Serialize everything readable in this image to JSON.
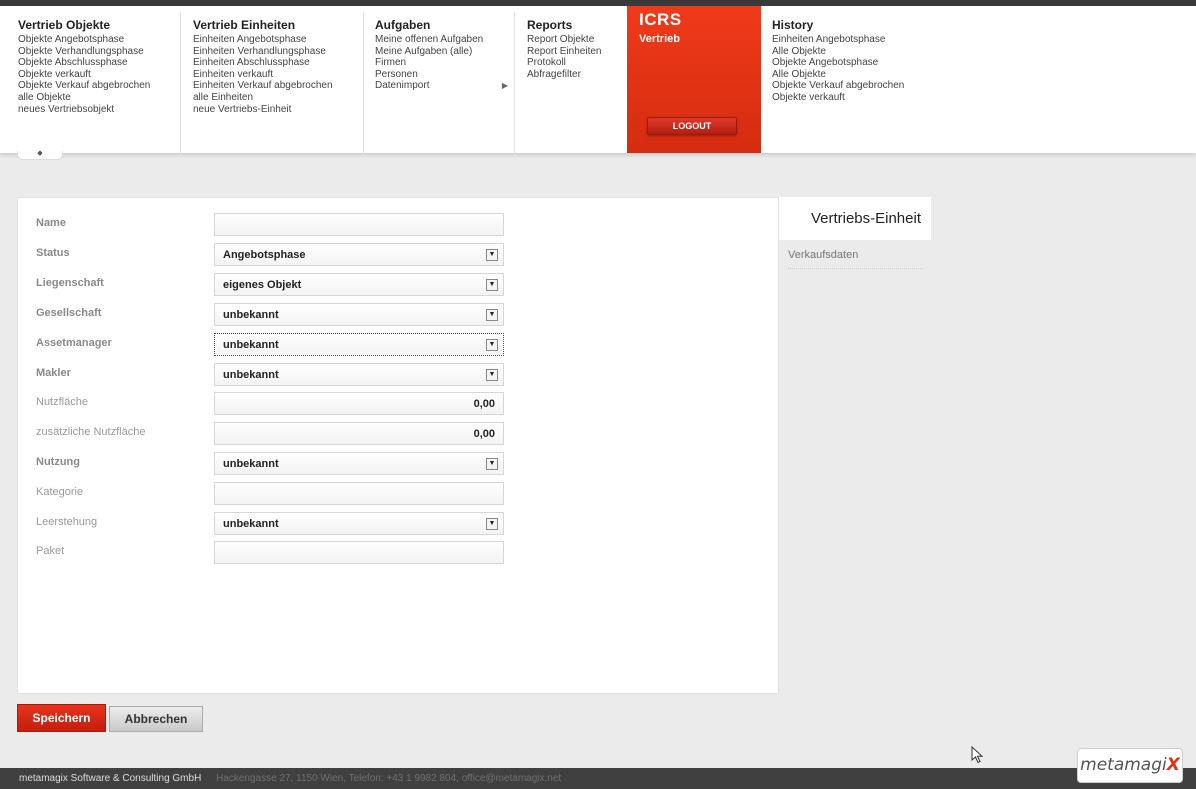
{
  "menu": {
    "vertrieb_objekte": {
      "title": "Vertrieb Objekte",
      "items": [
        "Objekte Angebotsphase",
        "Objekte Verhandlungsphase",
        "Objekte Abschlussphase",
        "Objekte verkauft",
        "Objekte Verkauf abgebrochen",
        "alle Objekte",
        "neues Vertriebsobjekt"
      ]
    },
    "vertrieb_einheiten": {
      "title": "Vertrieb Einheiten",
      "items": [
        "Einheiten Angebotsphase",
        "Einheiten Verhandlungsphase",
        "Einheiten Abschlussphase",
        "Einheiten verkauft",
        "Einheiten Verkauf abgebrochen",
        "alle Einheiten",
        "neue Vertriebs-Einheit"
      ]
    },
    "aufgaben": {
      "title": "Aufgaben",
      "items": [
        "Meine offenen Aufgaben",
        "Meine Aufgaben (alle)",
        "Firmen",
        "Personen",
        "Datenimport"
      ]
    },
    "reports": {
      "title": "Reports",
      "items": [
        "Report Objekte",
        "Report Einheiten",
        "Protokoll",
        "Abfragefilter"
      ]
    },
    "icrs": {
      "title": "ICRS",
      "subtitle": "Vertrieb",
      "logout": "LOGOUT"
    },
    "history": {
      "title": "History",
      "items": [
        "Einheiten Angebotsphase",
        "Alle Objekte",
        "Objekte Angebotsphase",
        "Alle Objekte",
        "Objekte Verkauf abgebrochen",
        "Objekte verkauft"
      ]
    }
  },
  "form": {
    "fields": [
      {
        "label": "Name",
        "value": "",
        "type": "text",
        "bold": true
      },
      {
        "label": "Status",
        "value": "Angebotsphase",
        "type": "select",
        "bold": true
      },
      {
        "label": "Liegenschaft",
        "value": "eigenes Objekt",
        "type": "select",
        "bold": true
      },
      {
        "label": "Gesellschaft",
        "value": "unbekannt",
        "type": "select",
        "bold": true
      },
      {
        "label": "Assetmanager",
        "value": "unbekannt",
        "type": "select",
        "bold": true
      },
      {
        "label": "Makler",
        "value": "unbekannt",
        "type": "select",
        "bold": true
      },
      {
        "label": "Nutzfläche",
        "value": "0,00",
        "type": "number",
        "bold": false
      },
      {
        "label": "zusätzliche Nutzfläche",
        "value": "0,00",
        "type": "number",
        "bold": false
      },
      {
        "label": "Nutzung",
        "value": "unbekannt",
        "type": "select",
        "bold": true
      },
      {
        "label": "Kategorie",
        "value": "",
        "type": "text",
        "bold": false
      },
      {
        "label": "Leerstehung",
        "value": "unbekannt",
        "type": "select",
        "bold": false
      },
      {
        "label": "Paket",
        "value": "",
        "type": "text",
        "bold": false
      }
    ]
  },
  "side_tabs": {
    "active": "Vertriebs-Einheit",
    "other": "Verkaufsdaten"
  },
  "buttons": {
    "save": "Speichern",
    "cancel": "Abbrechen"
  },
  "footer": {
    "company": "metamagix Software & Consulting GmbH",
    "address": "Hackengasse 27, 1150 Wien, Telefon: +43 1 9982 804, office@metamagix.net"
  },
  "logo": {
    "text": "metamagi",
    "accent": "X"
  },
  "colors": {
    "accent_red": "#e53316",
    "footer_bg": "#404040"
  }
}
